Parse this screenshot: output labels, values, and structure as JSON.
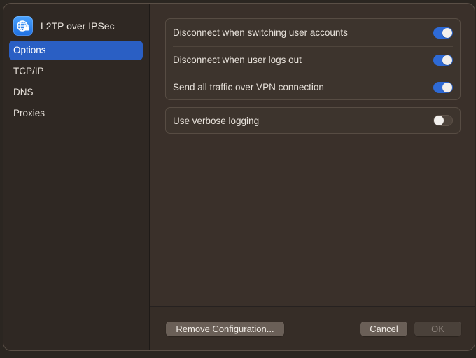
{
  "sidebar": {
    "title": "L2TP over IPSec",
    "icon": "vpn-globe-icon",
    "items": [
      {
        "label": "Options",
        "selected": true
      },
      {
        "label": "TCP/IP",
        "selected": false
      },
      {
        "label": "DNS",
        "selected": false
      },
      {
        "label": "Proxies",
        "selected": false
      }
    ]
  },
  "options": {
    "rows": [
      {
        "label": "Disconnect when switching user accounts",
        "enabled": true
      },
      {
        "label": "Disconnect when user logs out",
        "enabled": true
      },
      {
        "label": "Send all traffic over VPN connection",
        "enabled": true
      }
    ],
    "verbose": {
      "label": "Use verbose logging",
      "enabled": false
    }
  },
  "footer": {
    "remove_label": "Remove Configuration...",
    "cancel_label": "Cancel",
    "ok_label": "OK"
  },
  "colors": {
    "accent": "#2a5fc4",
    "toggle_on": "#2e6ad6"
  }
}
